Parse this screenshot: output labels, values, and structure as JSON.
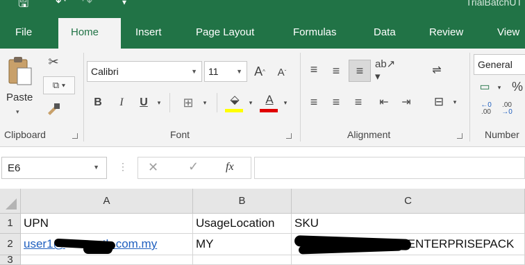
{
  "titlebar": {
    "title": "TrialBatchUT"
  },
  "tabs": [
    "File",
    "Home",
    "Insert",
    "Page Layout",
    "Formulas",
    "Data",
    "Review",
    "View"
  ],
  "active_tab": "Home",
  "ribbon": {
    "clipboard": {
      "label": "Clipboard",
      "paste_label": "Paste"
    },
    "font": {
      "label": "Font",
      "font_name": "Calibri",
      "font_size": "11",
      "bold": "B",
      "italic": "I",
      "underline": "U",
      "grow": "A",
      "shrink": "A",
      "font_color_letter": "A"
    },
    "alignment": {
      "label": "Alignment"
    },
    "number": {
      "label": "Number",
      "format": "General",
      "percent": "%",
      "inc_decimal": ".00",
      "dec_decimal": ".00"
    }
  },
  "formula_bar": {
    "name_box": "E6",
    "fx_label": "fx",
    "cancel": "✕",
    "enter": "✓",
    "content": ""
  },
  "grid": {
    "columns": [
      "A",
      "B",
      "C"
    ],
    "rows": [
      {
        "num": "1",
        "cells": [
          "UPN",
          "UsageLocation",
          "SKU"
        ]
      },
      {
        "num": "2",
        "cells": [
          "user1@",
          "MY",
          ":ENTERPRISEPACK"
        ],
        "a_suffix": "th.com.my"
      },
      {
        "num": "3",
        "cells": [
          "",
          "",
          ""
        ]
      }
    ]
  },
  "colors": {
    "excel_green": "#217346",
    "ribbon_bg": "#f3f3f3",
    "link": "#1f5fbf",
    "font_color_bar": "#e00000",
    "highlight_bar": "#ffff00"
  }
}
